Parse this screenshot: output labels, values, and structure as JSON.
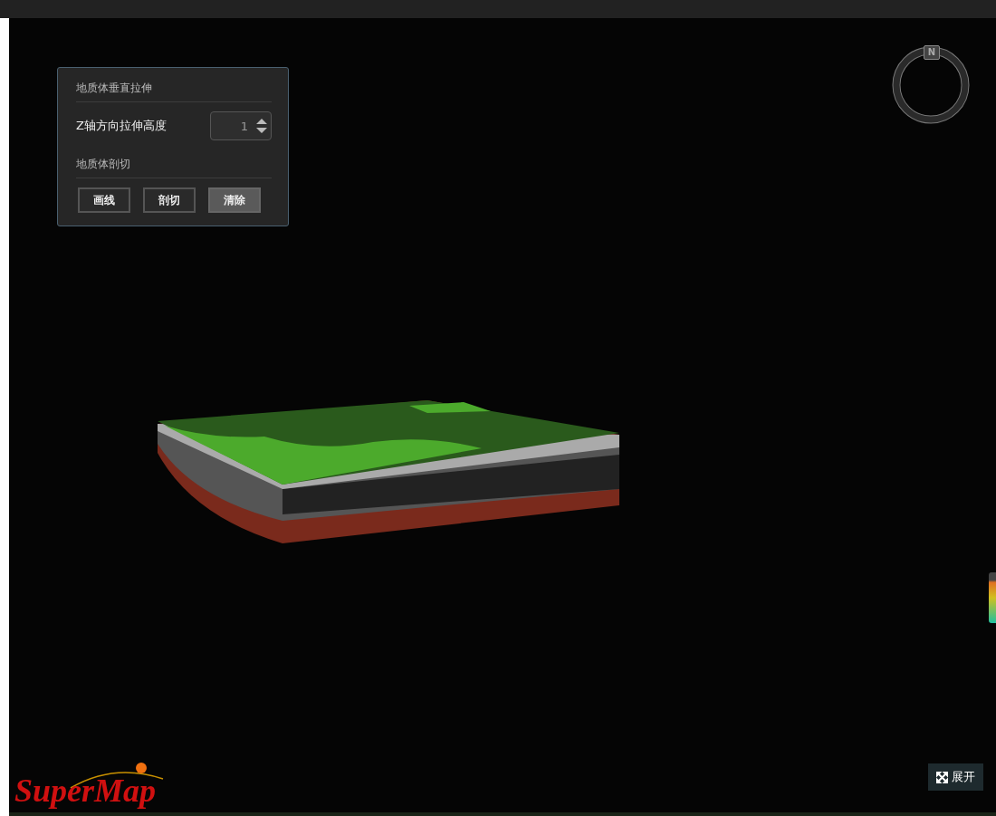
{
  "panel": {
    "sections": [
      {
        "title": "地质体垂直拉伸"
      },
      {
        "title": "地质体剖切"
      }
    ],
    "stretch": {
      "label": "Z轴方向拉伸高度",
      "value": "1"
    },
    "buttons": [
      {
        "label": "画线",
        "active": false
      },
      {
        "label": "剖切",
        "active": false
      },
      {
        "label": "清除",
        "active": true
      }
    ]
  },
  "compass": {
    "label": "N"
  },
  "logo": {
    "text": "SuperMap"
  },
  "expand_button": {
    "label": "展开"
  }
}
